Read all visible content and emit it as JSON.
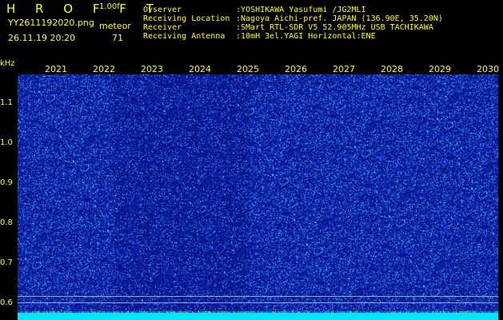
{
  "header": {
    "app_title": "H R O F F T",
    "version": "1.00f",
    "file_name": "YY2611192020.png",
    "mode": "meteor",
    "datetime": "26.11.19 20:20",
    "count": "71",
    "info_labels": "Ovserver\nReceiving Location\nReceiver\nReceiving Antenna",
    "info_values": ":YOSHIKAWA Yasufumi /JG2MLI\n:Nagoya Aichi-pref. JAPAN (136.90E, 35.20N)\n:SMart RTL-SDR V5 52.905MHz USB TACHIKAWA\n:10mH 3el.YAGI Horizontal:ENE"
  },
  "plot": {
    "y_unit": "kHz",
    "y_ticks": [
      "1.1",
      "1.0",
      "0.9",
      "0.8",
      "0.7",
      "0.6"
    ],
    "x_labels": [
      "2021",
      "2022",
      "2023",
      "2024",
      "2025",
      "2026",
      "2027",
      "2028",
      "2029",
      "2030"
    ],
    "colors": {
      "text": "#ffff00",
      "background": "#000080",
      "signal": "#00e5ff",
      "grid": "#8fa8c8"
    }
  }
}
